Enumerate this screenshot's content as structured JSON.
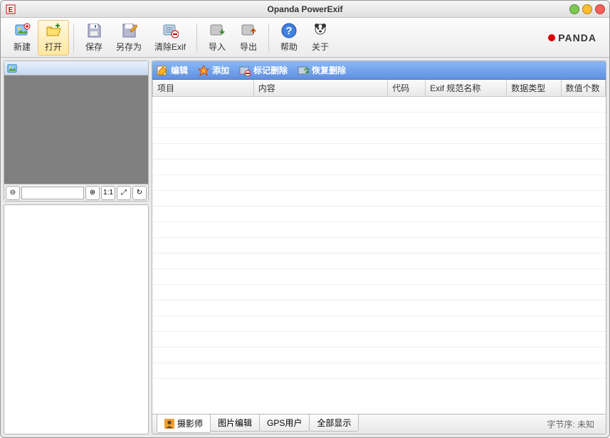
{
  "window": {
    "title": "Opanda PowerExif"
  },
  "brand": {
    "text": "PANDA"
  },
  "toolbar": {
    "new": "新建",
    "open": "打开",
    "save": "保存",
    "saveas": "另存为",
    "clear": "清除Exif",
    "import": "导入",
    "export": "导出",
    "help": "帮助",
    "about": "关于"
  },
  "actions": {
    "edit": "编辑",
    "add": "添加",
    "mark_delete": "标记删除",
    "restore_delete": "恢复删除"
  },
  "columns": {
    "item": "项目",
    "content": "内容",
    "code": "代码",
    "exif_name": "Exif 规范名称",
    "data_type": "数据类型",
    "count": "数值个数"
  },
  "tabs": {
    "photographer": "摄影师",
    "image_edit": "图片编辑",
    "gps": "GPS用户",
    "show_all": "全部显示"
  },
  "zoom": {
    "ratio_1_1": "1:1"
  },
  "status": {
    "byte_order": "字节序: 未知"
  }
}
